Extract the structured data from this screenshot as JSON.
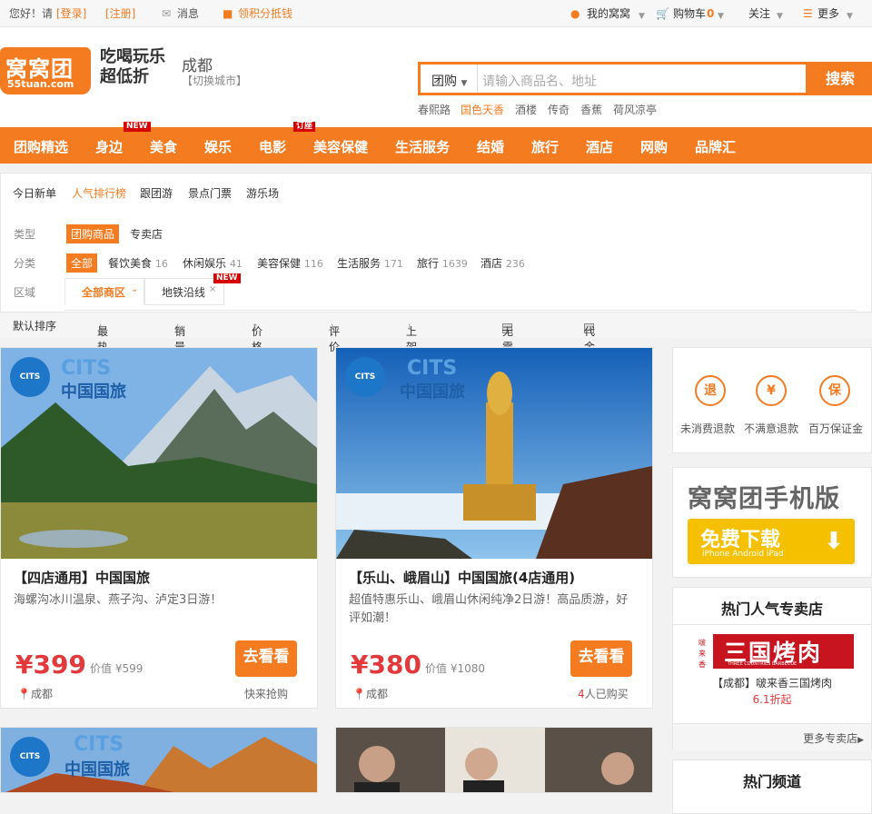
{
  "topbar": {
    "greeting": "您好！请",
    "login": "[登录]",
    "register": "[注册]",
    "message": "消息",
    "offset": "领积分抵钱",
    "my": "我的窝窝",
    "cart": "购物车",
    "cart_count": "0",
    "follow": "关注",
    "more": "更多"
  },
  "header": {
    "logo_cn": "窝窝团",
    "logo_en": "55tuan.com",
    "slogan_1": "吃喝玩乐",
    "slogan_2": "超低折",
    "city": "成都",
    "switch_city": "【切换城市】",
    "search_category": "团购",
    "search_placeholder": "请输入商品名、地址",
    "search_button": "搜索",
    "hot_words": [
      "春熙路",
      "国色天香",
      "酒楼",
      "传奇",
      "香蕉",
      "荷风凉亭"
    ]
  },
  "nav": {
    "items": [
      "团购精选",
      "身边",
      "美食",
      "娱乐",
      "电影",
      "美容保健",
      "生活服务",
      "结婚",
      "旅行",
      "酒店",
      "网购",
      "品牌汇"
    ],
    "tag_new": "NEW",
    "tag_order": "订座"
  },
  "filter": {
    "tabs": [
      "今日新单",
      "人气排行榜",
      "跟团游",
      "景点门票",
      "游乐场"
    ],
    "type_label": "类型",
    "type_options": [
      "团购商品",
      "专卖店"
    ],
    "category_label": "分类",
    "categories": [
      {
        "name": "全部",
        "count": ""
      },
      {
        "name": "餐饮美食",
        "count": "16"
      },
      {
        "name": "休闲娱乐",
        "count": "41"
      },
      {
        "name": "美容保健",
        "count": "116"
      },
      {
        "name": "生活服务",
        "count": "171"
      },
      {
        "name": "旅行",
        "count": "1639"
      },
      {
        "name": "酒店",
        "count": "236"
      }
    ],
    "area_label": "区域",
    "area_all": "全部商区",
    "area_subway": "地铁沿线",
    "area_tag": "NEW"
  },
  "sort": {
    "default": "默认排序",
    "options": [
      "最热",
      "销量",
      "价格",
      "评价",
      "上架时间"
    ],
    "checks": [
      "无需预约",
      "代金券"
    ]
  },
  "deals": [
    {
      "title": "【四店通用】中国国旅",
      "desc": "海螺沟冰川温泉、燕子沟、泸定3日游！",
      "price": "¥399",
      "value": "价值 ¥599",
      "button": "去看看",
      "location": "成都",
      "sold": "快来抢购"
    },
    {
      "title": "【乐山、峨眉山】中国国旅(4店通用)",
      "desc": "超值特惠乐山、峨眉山休闲纯净2日游！高品质游，好评如潮！",
      "price": "¥380",
      "value": "价值 ¥1080",
      "button": "去看看",
      "location": "成都",
      "sold_count": "4",
      "sold": "人已购买"
    }
  ],
  "brand": {
    "cits_en": "CITS",
    "cits_cn": "中国国旅"
  },
  "sidebar": {
    "guarantees": [
      {
        "icon": "退",
        "label": "未消费退款"
      },
      {
        "icon": "¥",
        "label": "不满意退款"
      },
      {
        "icon": "保",
        "label": "百万保证金"
      }
    ],
    "app_title": "窝窝团手机版",
    "app_download": "免费下载",
    "app_platforms": "iPhone Android iPad",
    "shops_title": "热门人气专卖店",
    "shop_banner": "三国烤肉",
    "shop_banner_sub": "THREE COUNTRIES BARBECUE",
    "shop_name": "【成都】啵来香三国烤肉",
    "shop_discount": "6.1折起",
    "more_shops": "更多专卖店",
    "channels_title": "热门频道"
  },
  "colors": {
    "brand_orange": "#f57b20",
    "price_red": "#e4393c"
  }
}
